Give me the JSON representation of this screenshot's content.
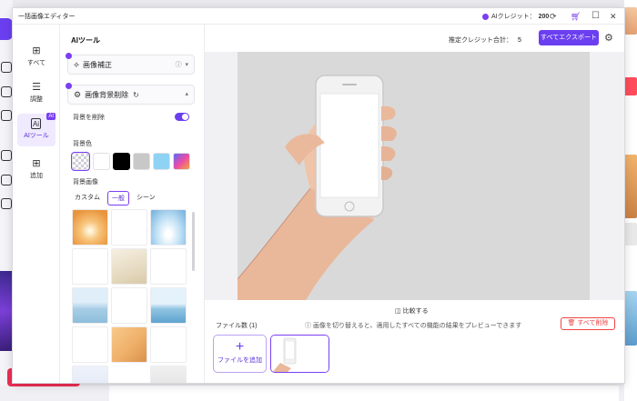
{
  "window": {
    "title": "一括画像エディター",
    "ai_credit_label": "AIクレジット：",
    "ai_credit_value": "200"
  },
  "nav": {
    "items": [
      {
        "label": "すべて",
        "icon": "grid-icon"
      },
      {
        "label": "調整",
        "icon": "sliders-icon"
      },
      {
        "label": "AIツール",
        "icon": "ai-icon",
        "badge": "AI"
      },
      {
        "label": "追加",
        "icon": "plus-box-icon"
      }
    ]
  },
  "panel": {
    "title": "AIツール",
    "tool1": {
      "label": "画像補正"
    },
    "tool2": {
      "label": "画像背景削除"
    },
    "remove_bg_label": "背景を削除",
    "bg_color_label": "背景色",
    "swatch_colors": [
      "transparent",
      "#ffffff",
      "#000000",
      "#c8c8c8",
      "#8fd3f4",
      "gradient"
    ],
    "bg_image_label": "背景画像",
    "tabs": [
      "カスタム",
      "一般",
      "シーン"
    ],
    "active_tab": "一般"
  },
  "main": {
    "credit_sum_label": "推定クレジット合計：",
    "credit_sum_value": "5",
    "export_label": "すべてエクスポート",
    "compare_label": "比較する",
    "files_label": "ファイル数 (1)",
    "hint": "画像を切り替えると、適用したすべての機能の結果をプレビューできます",
    "delete_all_label": "すべて削除",
    "add_file_label": "ファイルを追加"
  },
  "colors": {
    "accent": "#6b3ff0",
    "danger": "#ef4444",
    "preview_bg": "#d9d9d9"
  }
}
